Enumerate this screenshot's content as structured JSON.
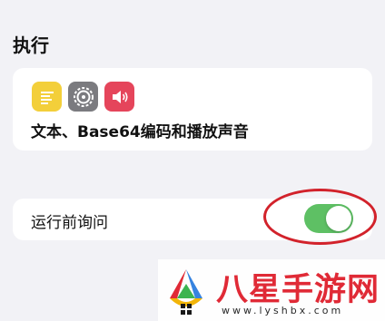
{
  "section_title": "执行",
  "actions_card": {
    "icons": [
      "text-icon",
      "settings-gear-icon",
      "speaker-sound-icon"
    ],
    "label": "文本、Base64编码和播放声音"
  },
  "ask_row": {
    "label": "运行前询问",
    "toggle_on": true
  },
  "watermark": {
    "title": "八星手游网",
    "url": "www.lyshbx.com"
  },
  "colors": {
    "background": "#f2f2f6",
    "toggle_on": "#5ec064",
    "highlight": "#d2222b",
    "text_icon": "#f3cf3a",
    "settings_icon": "#7b7b7f",
    "sound_icon": "#e5455b"
  }
}
